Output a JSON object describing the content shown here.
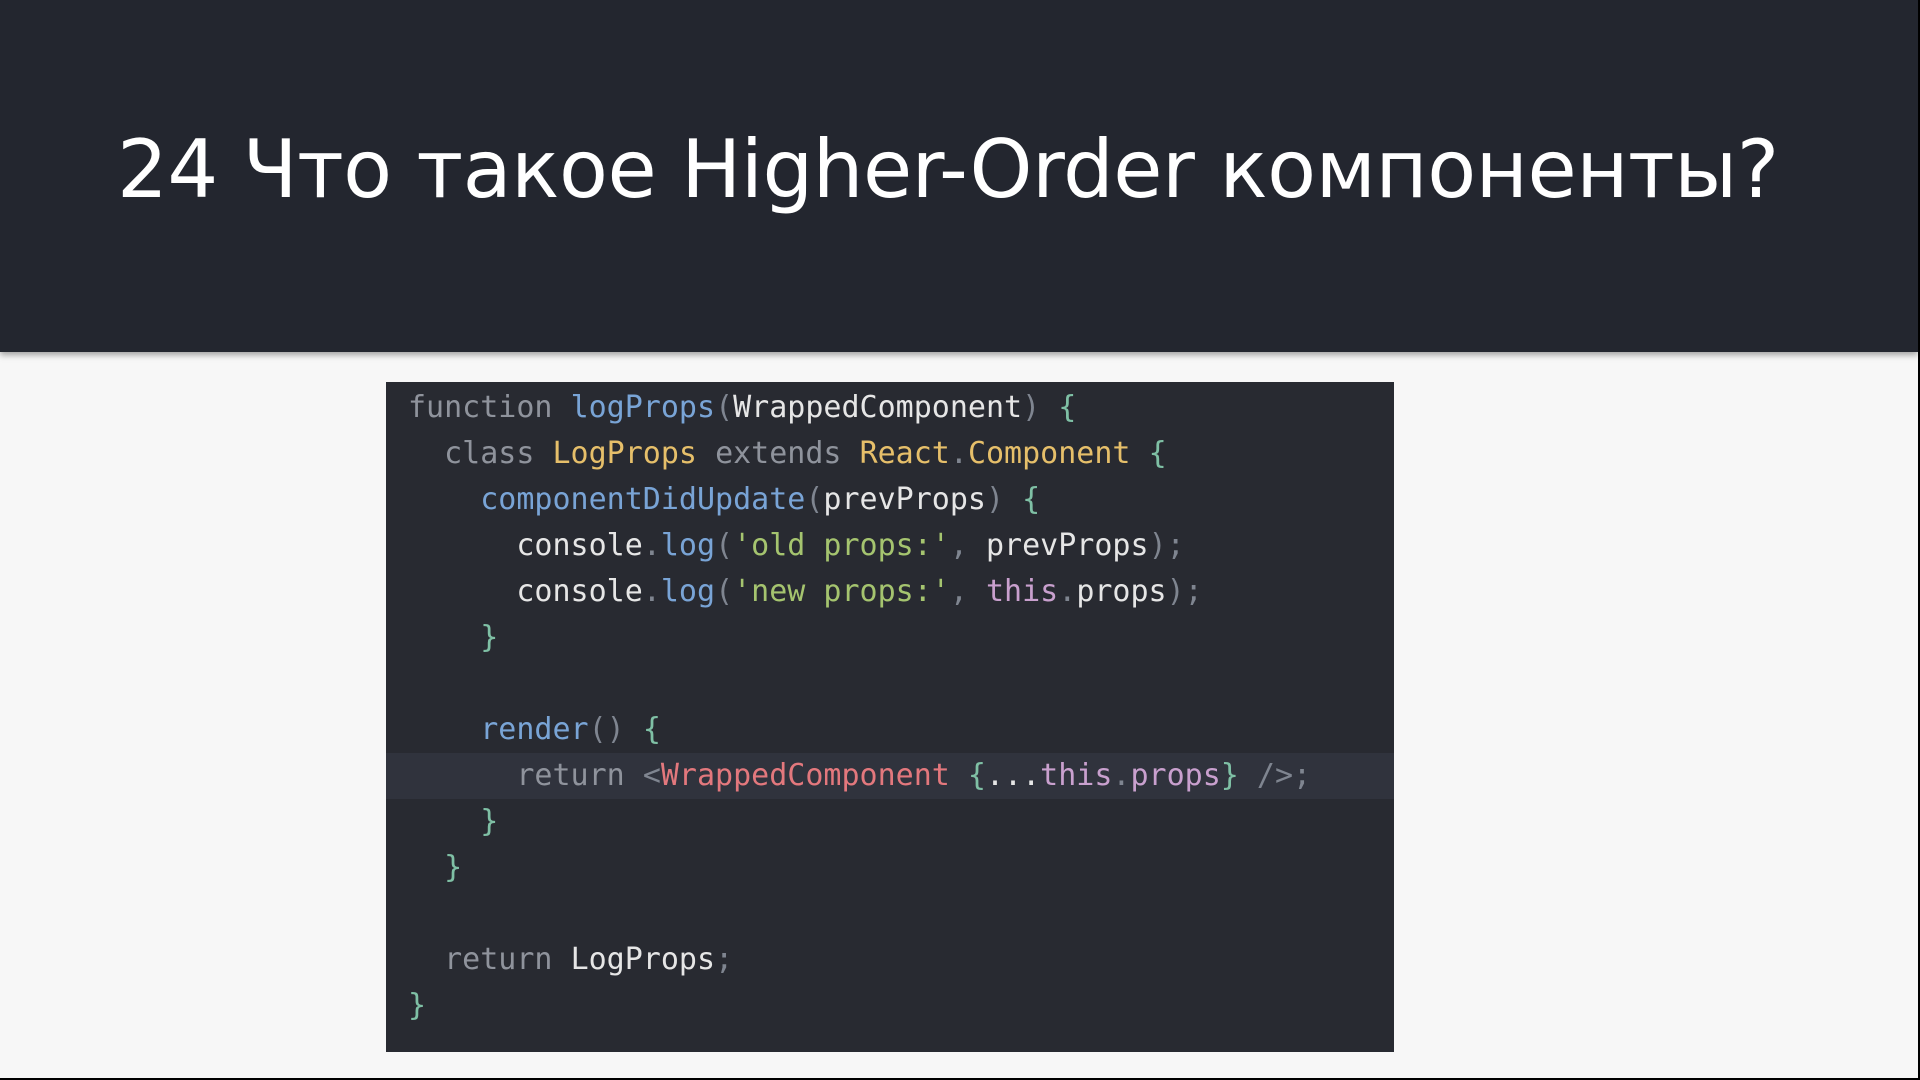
{
  "slide": {
    "title": "24 Что такое Higher-Order компоненты?"
  },
  "colors": {
    "header_bg": "#23262f",
    "slide_bg": "#f7f7f7",
    "code_bg": "#282a31",
    "highlight_bg": "#30333d"
  },
  "code": {
    "lines": [
      {
        "tokens": [
          {
            "t": "function ",
            "c": "kw"
          },
          {
            "t": "logProps",
            "c": "fn"
          },
          {
            "t": "(",
            "c": "pun"
          },
          {
            "t": "WrappedComponent",
            "c": "txt"
          },
          {
            "t": ") ",
            "c": "pun"
          },
          {
            "t": "{",
            "c": "br"
          }
        ]
      },
      {
        "tokens": [
          {
            "t": "  class ",
            "c": "kw"
          },
          {
            "t": "LogProps ",
            "c": "cls"
          },
          {
            "t": "extends ",
            "c": "kw"
          },
          {
            "t": "React",
            "c": "cls"
          },
          {
            "t": ".",
            "c": "pun"
          },
          {
            "t": "Component ",
            "c": "cls"
          },
          {
            "t": "{",
            "c": "br"
          }
        ]
      },
      {
        "tokens": [
          {
            "t": "    componentDidUpdate",
            "c": "fn"
          },
          {
            "t": "(",
            "c": "pun"
          },
          {
            "t": "prevProps",
            "c": "txt"
          },
          {
            "t": ") ",
            "c": "pun"
          },
          {
            "t": "{",
            "c": "br"
          }
        ]
      },
      {
        "tokens": [
          {
            "t": "      console",
            "c": "txt"
          },
          {
            "t": ".",
            "c": "pun"
          },
          {
            "t": "log",
            "c": "fn"
          },
          {
            "t": "(",
            "c": "pun"
          },
          {
            "t": "'old props:'",
            "c": "str"
          },
          {
            "t": ", ",
            "c": "pun"
          },
          {
            "t": "prevProps",
            "c": "txt"
          },
          {
            "t": ");",
            "c": "pun"
          }
        ]
      },
      {
        "tokens": [
          {
            "t": "      console",
            "c": "txt"
          },
          {
            "t": ".",
            "c": "pun"
          },
          {
            "t": "log",
            "c": "fn"
          },
          {
            "t": "(",
            "c": "pun"
          },
          {
            "t": "'new props:'",
            "c": "str"
          },
          {
            "t": ", ",
            "c": "pun"
          },
          {
            "t": "this",
            "c": "this"
          },
          {
            "t": ".",
            "c": "pun"
          },
          {
            "t": "props",
            "c": "txt"
          },
          {
            "t": ");",
            "c": "pun"
          }
        ]
      },
      {
        "tokens": [
          {
            "t": "    }",
            "c": "br"
          }
        ]
      },
      {
        "tokens": []
      },
      {
        "tokens": [
          {
            "t": "    render",
            "c": "fn"
          },
          {
            "t": "() ",
            "c": "pun"
          },
          {
            "t": "{",
            "c": "br"
          }
        ]
      },
      {
        "highlight": true,
        "tokens": [
          {
            "t": "      return ",
            "c": "kw"
          },
          {
            "t": "<",
            "c": "pun"
          },
          {
            "t": "WrappedComponent ",
            "c": "tag"
          },
          {
            "t": "{",
            "c": "br"
          },
          {
            "t": "...",
            "c": "txt"
          },
          {
            "t": "this",
            "c": "this"
          },
          {
            "t": ".",
            "c": "pun"
          },
          {
            "t": "props",
            "c": "this"
          },
          {
            "t": "} ",
            "c": "br"
          },
          {
            "t": "/>;",
            "c": "pun"
          }
        ]
      },
      {
        "tokens": [
          {
            "t": "    }",
            "c": "br"
          }
        ]
      },
      {
        "tokens": [
          {
            "t": "  }",
            "c": "br"
          }
        ]
      },
      {
        "tokens": []
      },
      {
        "tokens": [
          {
            "t": "  return ",
            "c": "kw"
          },
          {
            "t": "LogProps",
            "c": "txt"
          },
          {
            "t": ";",
            "c": "pun"
          }
        ]
      },
      {
        "tokens": [
          {
            "t": "}",
            "c": "br"
          }
        ]
      }
    ]
  }
}
